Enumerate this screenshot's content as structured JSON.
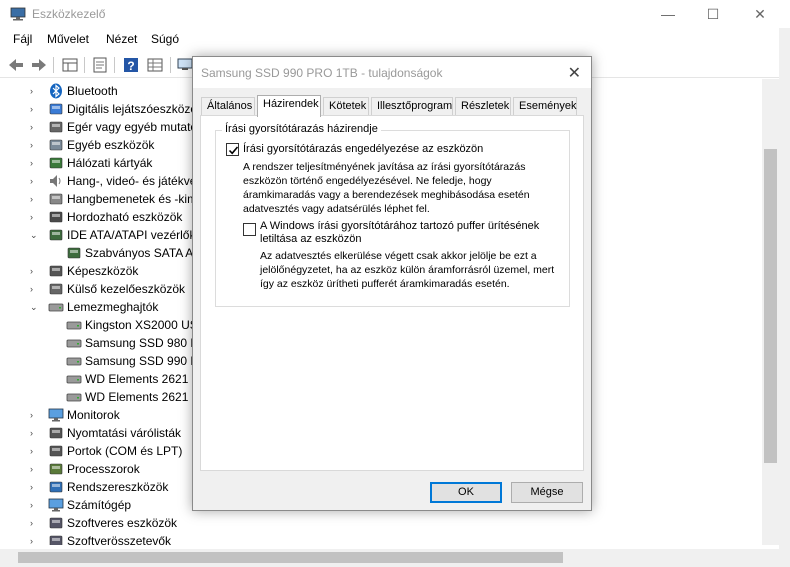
{
  "window": {
    "title": "Eszközkezelő",
    "minimize": "—",
    "maximize": "☐",
    "close": "✕"
  },
  "menu": [
    "Fájl",
    "Művelet",
    "Nézet",
    "Súgó"
  ],
  "tree": [
    {
      "label": "Bluetooth",
      "icon": "bluetooth-icon",
      "expanded": false
    },
    {
      "label": "Digitális lejátszóeszközök",
      "icon": "media-device-icon",
      "expanded": false
    },
    {
      "label": "Egér vagy egyéb mutató",
      "icon": "mouse-icon",
      "expanded": false
    },
    {
      "label": "Egyéb eszközök",
      "icon": "other-device-icon",
      "expanded": false
    },
    {
      "label": "Hálózati kártyák",
      "icon": "network-adapter-icon",
      "expanded": false
    },
    {
      "label": "Hang-, videó- és játékve",
      "icon": "speaker-icon",
      "expanded": false
    },
    {
      "label": "Hangbemenetek és -kim",
      "icon": "audio-io-icon",
      "expanded": false
    },
    {
      "label": "Hordozható eszközök",
      "icon": "portable-device-icon",
      "expanded": false
    },
    {
      "label": "IDE ATA/ATAPI vezérlők",
      "icon": "ide-controller-icon",
      "expanded": true
    },
    {
      "label": "Szabványos SATA AH",
      "icon": "sata-controller-icon",
      "child": true
    },
    {
      "label": "Képeszközök",
      "icon": "camera-icon",
      "expanded": false
    },
    {
      "label": "Külső kezelőeszközök",
      "icon": "usb-device-icon",
      "expanded": false
    },
    {
      "label": "Lemezmeghajtók",
      "icon": "disk-drive-icon",
      "expanded": true
    },
    {
      "label": "Kingston XS2000 USE",
      "icon": "drive-icon",
      "child": true
    },
    {
      "label": "Samsung SSD 980 PF",
      "icon": "drive-icon",
      "child": true
    },
    {
      "label": "Samsung SSD 990 PF",
      "icon": "drive-icon",
      "child": true
    },
    {
      "label": "WD Elements 2621 U",
      "icon": "drive-icon",
      "child": true
    },
    {
      "label": "WD Elements 2621 U",
      "icon": "drive-icon",
      "child": true
    },
    {
      "label": "Monitorok",
      "icon": "monitor-icon",
      "expanded": false
    },
    {
      "label": "Nyomtatási várólisták",
      "icon": "printer-icon",
      "expanded": false
    },
    {
      "label": "Portok (COM és LPT)",
      "icon": "port-icon",
      "expanded": false
    },
    {
      "label": "Processzorok",
      "icon": "processor-icon",
      "expanded": false
    },
    {
      "label": "Rendszereszközök",
      "icon": "system-device-icon",
      "expanded": false
    },
    {
      "label": "Számítógép",
      "icon": "computer-icon",
      "expanded": false
    },
    {
      "label": "Szoftveres eszközök",
      "icon": "software-device-icon",
      "expanded": false
    },
    {
      "label": "Szoftverösszetevők",
      "icon": "software-component-icon",
      "expanded": false
    }
  ],
  "dialog": {
    "title": "Samsung SSD 990 PRO 1TB - tulajdonságok",
    "close": "✕",
    "tabs": [
      "Általános",
      "Házirendek",
      "Kötetek",
      "Illesztőprogram",
      "Részletek",
      "Események"
    ],
    "active_tab": "Házirendek",
    "group_title": "Írási gyorsítótárazás házirendje",
    "option1": {
      "label": "Írási gyorsítótárazás engedélyezése az eszközön",
      "checked": true,
      "desc": [
        "A rendszer teljesítményének javítása az írási gyorsítótárazás",
        "eszközön történő engedélyezésével. Ne feledje, hogy",
        "áramkimaradás vagy a berendezések meghibásodása esetén",
        "adatvesztés vagy adatsérülés léphet fel."
      ]
    },
    "option2": {
      "label": [
        "A Windows írási gyorsítótárához tartozó puffer ürítésének",
        "letiltása az eszközön"
      ],
      "checked": false,
      "desc": [
        "Az adatvesztés elkerülése végett csak akkor jelölje be ezt a",
        "jelölőnégyzetet, ha az eszköz külön áramforrásról üzemel, mert",
        "így az eszköz ürítheti pufferét áramkimaradás esetén."
      ]
    },
    "ok": "OK",
    "cancel": "Mégse"
  }
}
